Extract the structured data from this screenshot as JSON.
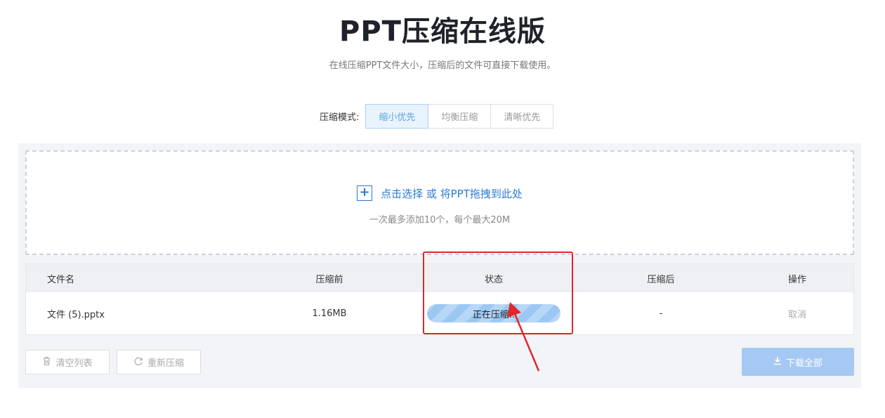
{
  "page": {
    "title": "PPT压缩在线版",
    "subtitle": "在线压缩PPT文件大小，压缩后的文件可直接下载使用。"
  },
  "mode": {
    "label": "压缩模式:",
    "options": [
      "缩小优先",
      "均衡压缩",
      "清晰优先"
    ],
    "selected": "缩小优先"
  },
  "dropzone": {
    "plus_icon": "plus-icon",
    "action_text": "点击选择 或 将PPT拖拽到此处",
    "hint": "一次最多添加10个，每个最大20M"
  },
  "table": {
    "headers": {
      "name": "文件名",
      "before": "压缩前",
      "status": "状态",
      "after": "压缩后",
      "operation": "操作"
    },
    "rows": [
      {
        "name": "文件 (5).pptx",
        "before": "1.16MB",
        "status": "正在压缩..",
        "after": "-",
        "operation": "取消"
      }
    ]
  },
  "actions": {
    "clear": "清空列表",
    "recompress": "重新压缩",
    "download_all": "下载全部"
  },
  "colors": {
    "accent": "#2b7bd3",
    "highlight": "#e0272a",
    "primary_disabled": "#a6c9f3"
  }
}
